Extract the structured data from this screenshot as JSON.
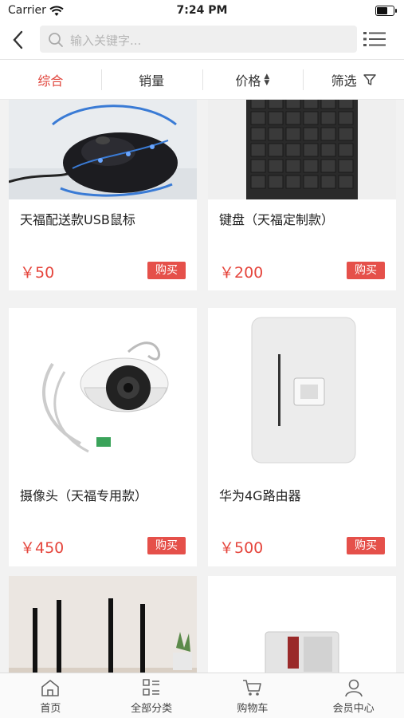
{
  "status_bar": {
    "carrier": "Carrier",
    "time": "7:24 PM"
  },
  "search": {
    "placeholder": "输入关键字..."
  },
  "filters": [
    {
      "label": "综合",
      "active": true
    },
    {
      "label": "销量"
    },
    {
      "label": "价格"
    },
    {
      "label": "筛选"
    }
  ],
  "products": [
    {
      "name": "天福配送款USB鼠标",
      "price": "￥50",
      "buy_label": "购买",
      "image_icon": "usb-mouse-image"
    },
    {
      "name": "键盘（天福定制款）",
      "price": "￥200",
      "buy_label": "购买",
      "image_icon": "keyboard-image"
    },
    {
      "name": "摄像头（天福专用款）",
      "price": "￥450",
      "buy_label": "购买",
      "image_icon": "dome-camera-image"
    },
    {
      "name": "华为4G路由器",
      "price": "￥500",
      "buy_label": "购买",
      "image_icon": "router-image"
    },
    {
      "name": "",
      "price": "",
      "buy_label": "",
      "image_icon": "antenna-router-image"
    },
    {
      "name": "",
      "price": "",
      "buy_label": "",
      "image_icon": "device-image"
    }
  ],
  "tabbar": [
    {
      "label": "首页",
      "icon": "home-icon"
    },
    {
      "label": "全部分类",
      "icon": "category-icon"
    },
    {
      "label": "购物车",
      "icon": "cart-icon"
    },
    {
      "label": "会员中心",
      "icon": "user-icon"
    }
  ],
  "colors": {
    "accent": "#e5453c",
    "buy_button": "#e5504a",
    "background": "#f2f2f2"
  }
}
